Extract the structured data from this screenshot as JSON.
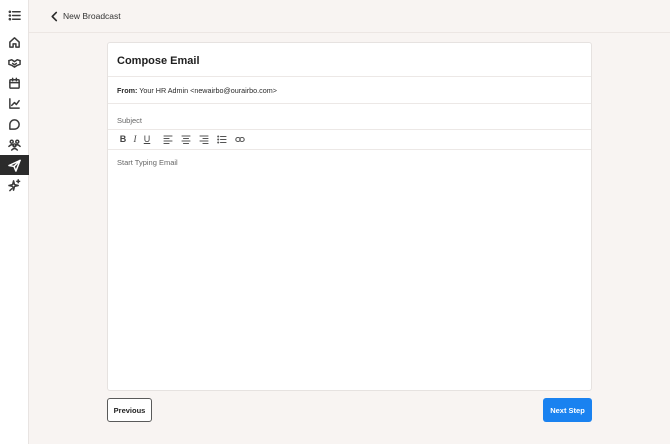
{
  "sidebar": {
    "items": [
      {
        "icon": "list-menu-icon"
      },
      {
        "icon": "home-icon"
      },
      {
        "icon": "handshake-icon"
      },
      {
        "icon": "calendar-icon"
      },
      {
        "icon": "chart-icon"
      },
      {
        "icon": "chat-icon"
      },
      {
        "icon": "team-icon"
      },
      {
        "icon": "send-icon",
        "active": true
      },
      {
        "icon": "sparkle-icon"
      }
    ]
  },
  "header": {
    "title": "New Broadcast"
  },
  "compose": {
    "title": "Compose Email",
    "from_label": "From:",
    "from_value": "Your HR Admin <newairbo@ourairbo.com>",
    "subject_placeholder": "Subject",
    "body_placeholder": "Start Typing Email",
    "toolbar": {
      "bold": "B",
      "italic": "I",
      "underline": "U"
    }
  },
  "footer": {
    "previous_label": "Previous",
    "next_label": "Next Step",
    "accent_color": "#1a82f0"
  }
}
